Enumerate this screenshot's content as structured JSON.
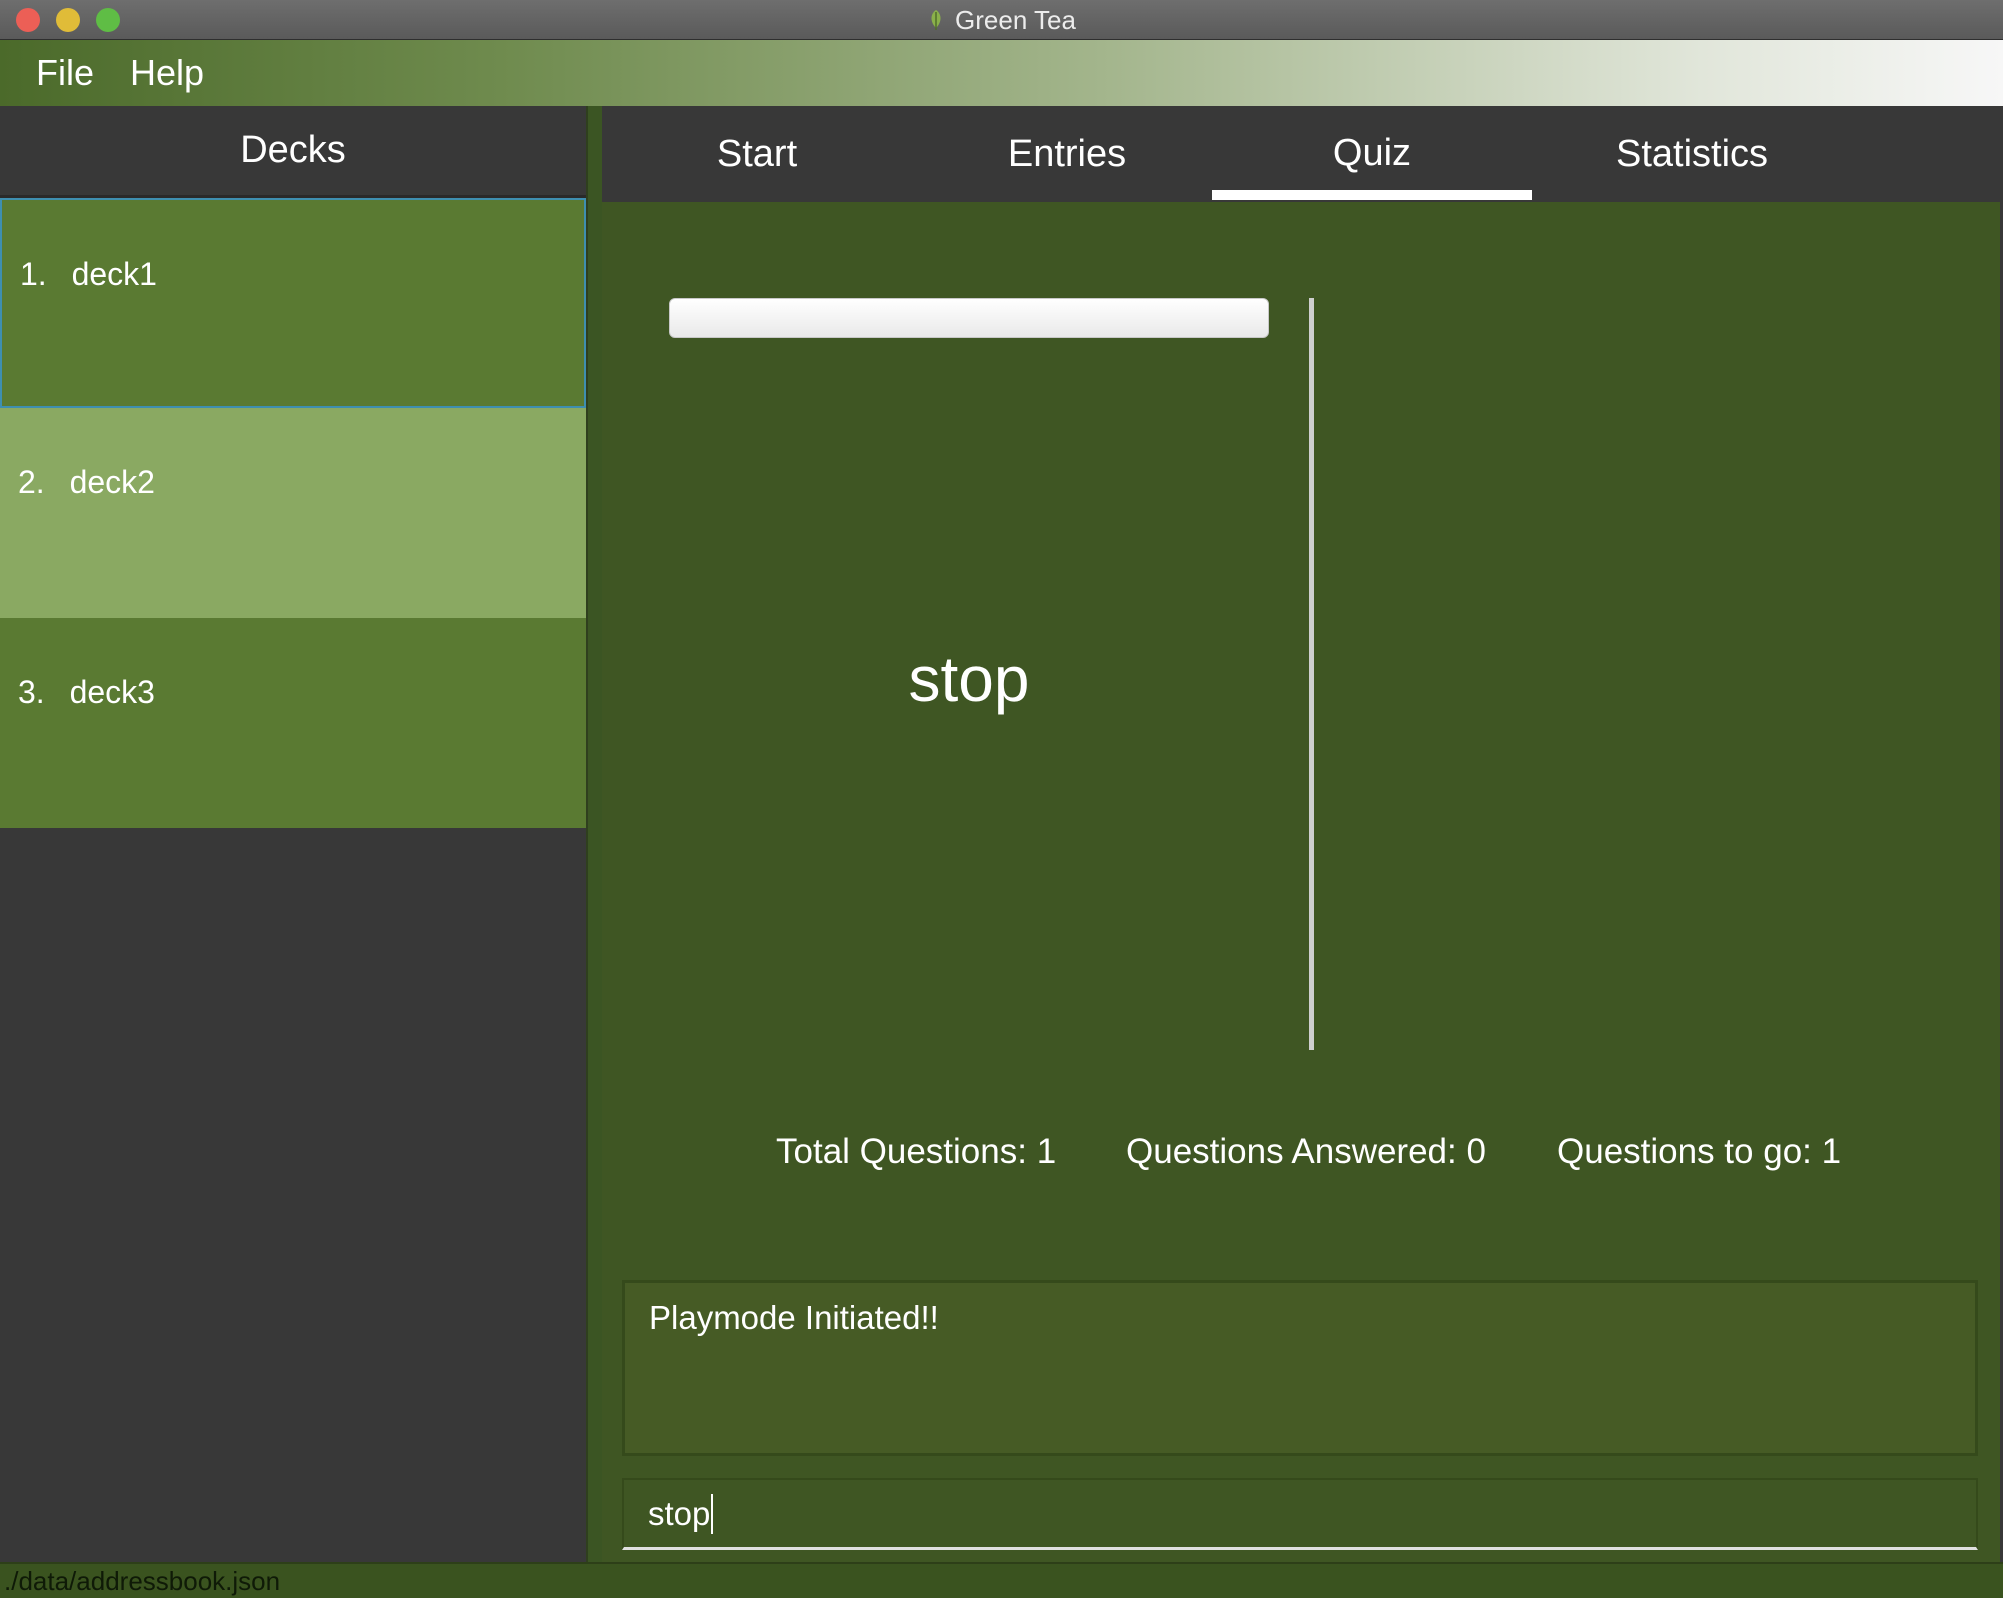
{
  "window": {
    "title": "Green Tea"
  },
  "menu": {
    "items": [
      "File",
      "Help"
    ]
  },
  "decks": {
    "header": "Decks",
    "items": [
      {
        "number": "1.",
        "name": "deck1"
      },
      {
        "number": "2.",
        "name": "deck2"
      },
      {
        "number": "3.",
        "name": "deck3"
      }
    ],
    "selected_index": 0
  },
  "tabs": {
    "items": [
      "Start",
      "Entries",
      "Quiz",
      "Statistics"
    ],
    "active": "Quiz"
  },
  "quiz": {
    "question": "stop",
    "progress_fraction": 0,
    "stats": {
      "total": "Total Questions: 1",
      "answered": "Questions Answered: 0",
      "to_go": "Questions to go: 1"
    }
  },
  "result": {
    "text": "Playmode Initiated!!"
  },
  "command": {
    "value": "stop"
  },
  "status": {
    "path": "./data/addressbook.json"
  },
  "colors": {
    "accent_green": "#3f5623",
    "deck_green": "#5a7a32",
    "deck_highlight": "#8aa962",
    "panel_dark": "#383838"
  }
}
